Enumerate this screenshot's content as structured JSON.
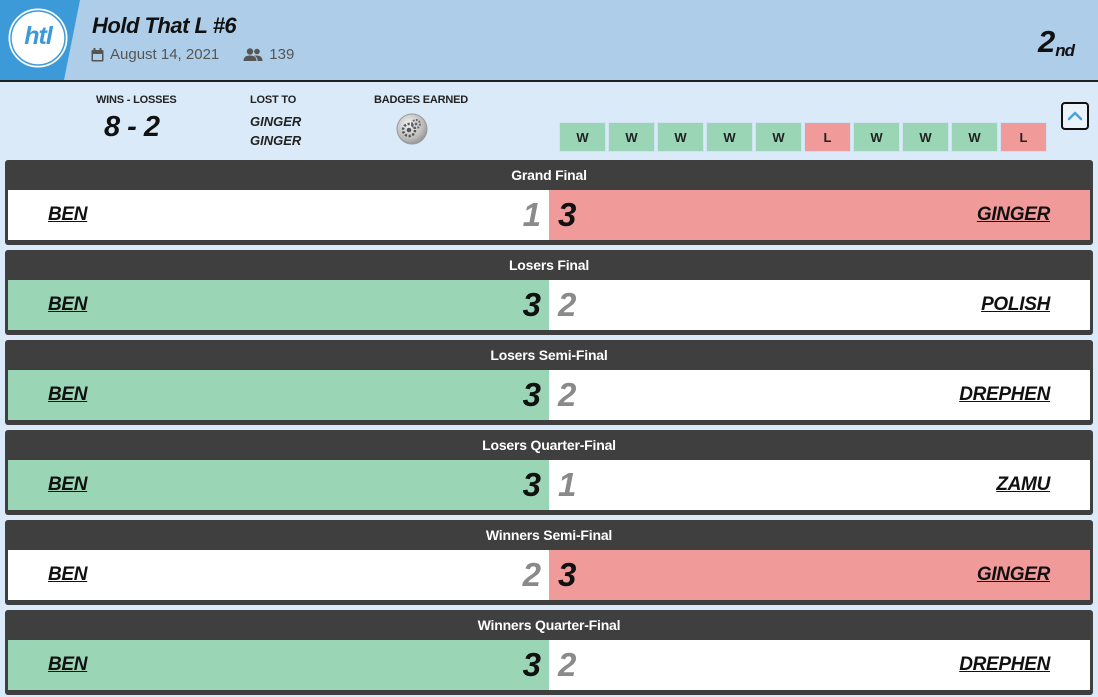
{
  "header": {
    "logo_text": "htl",
    "title": "Hold That L #6",
    "date": "August 14, 2021",
    "participants": "139",
    "placement_number": "2",
    "placement_suffix": "nd"
  },
  "summary": {
    "wins_losses_label": "WINS - LOSSES",
    "record": "8 - 2",
    "lost_to_label": "LOST TO",
    "lost_to": [
      "GINGER",
      "GINGER"
    ],
    "badges_label": "BADGES EARNED",
    "badges": [
      "gear-badge-icon"
    ]
  },
  "results": [
    "W",
    "W",
    "W",
    "W",
    "W",
    "L",
    "W",
    "W",
    "W",
    "L"
  ],
  "colors": {
    "win": "#9ad6b6",
    "loss": "#f09a9a",
    "header_bg": "#aecde9",
    "page_bg": "#dbeaf8",
    "round_bar": "#3f3f3f"
  },
  "matches": [
    {
      "round": "Grand Final",
      "player": "BEN",
      "player_score": "1",
      "opponent": "GINGER",
      "opponent_score": "3",
      "won": false
    },
    {
      "round": "Losers Final",
      "player": "BEN",
      "player_score": "3",
      "opponent": "POLISH",
      "opponent_score": "2",
      "won": true
    },
    {
      "round": "Losers Semi-Final",
      "player": "BEN",
      "player_score": "3",
      "opponent": "DREPHEN",
      "opponent_score": "2",
      "won": true
    },
    {
      "round": "Losers Quarter-Final",
      "player": "BEN",
      "player_score": "3",
      "opponent": "ZAMU",
      "opponent_score": "1",
      "won": true
    },
    {
      "round": "Winners Semi-Final",
      "player": "BEN",
      "player_score": "2",
      "opponent": "GINGER",
      "opponent_score": "3",
      "won": false
    },
    {
      "round": "Winners Quarter-Final",
      "player": "BEN",
      "player_score": "3",
      "opponent": "DREPHEN",
      "opponent_score": "2",
      "won": true
    }
  ]
}
